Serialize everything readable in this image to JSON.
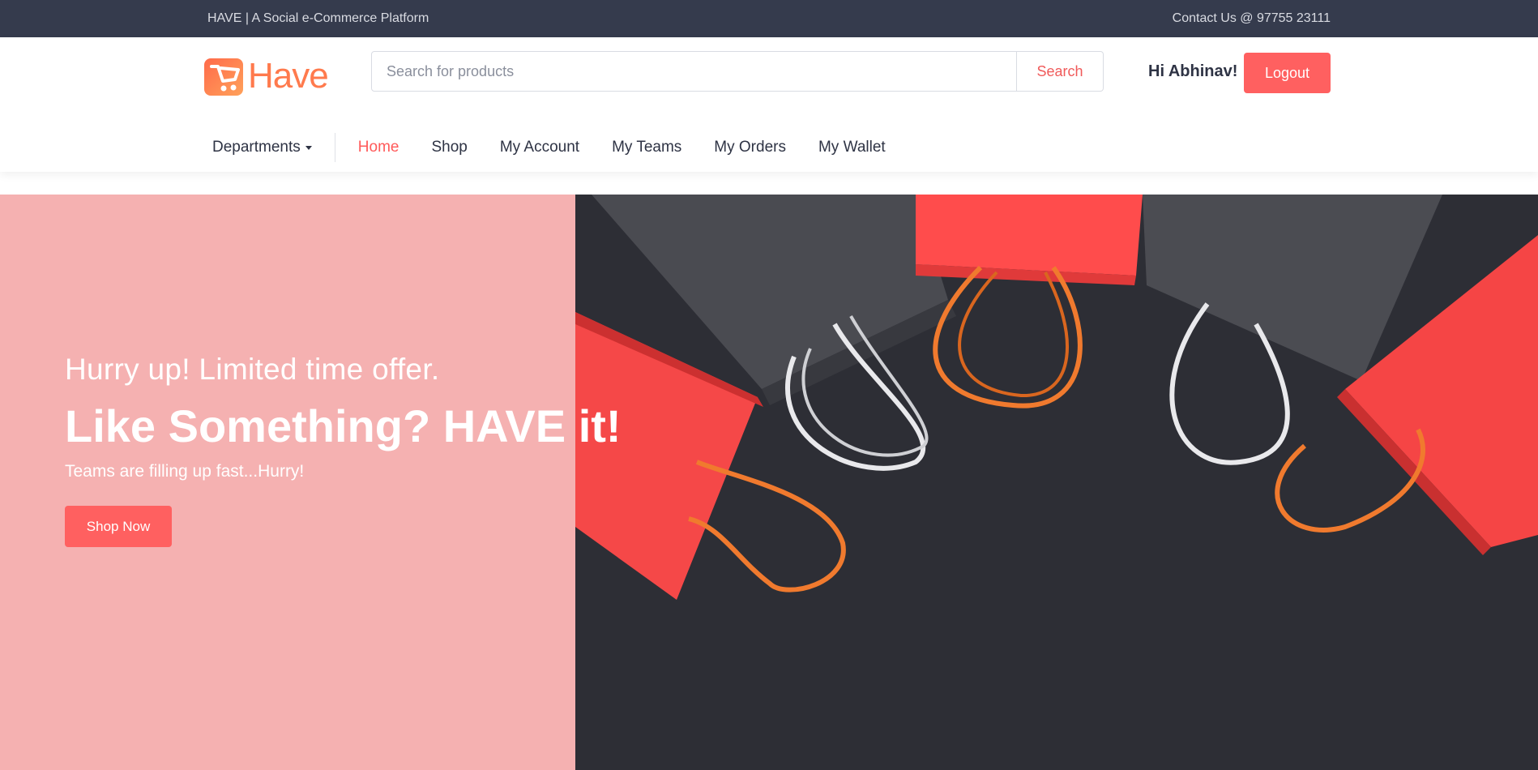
{
  "topbar": {
    "tagline": "HAVE | A Social e-Commerce Platform",
    "contact": "Contact Us @ 97755 23111"
  },
  "header": {
    "logo_text": "Have",
    "search": {
      "placeholder": "Search for products",
      "value": "",
      "button_label": "Search"
    },
    "greeting": "Hi Abhinav!",
    "logout_label": "Logout"
  },
  "nav": {
    "departments_label": "Departments",
    "links": [
      {
        "label": "Home",
        "active": true
      },
      {
        "label": "Shop",
        "active": false
      },
      {
        "label": "My Account",
        "active": false
      },
      {
        "label": "My Teams",
        "active": false
      },
      {
        "label": "My Orders",
        "active": false
      },
      {
        "label": "My Wallet",
        "active": false
      }
    ]
  },
  "hero": {
    "kicker": "Hurry up! Limited time offer.",
    "title": "Like Something? HAVE it!",
    "subtitle": "Teams are filling up fast...Hurry!",
    "cta_label": "Shop Now"
  },
  "colors": {
    "topbar_bg": "#353b4d",
    "accent": "#ff6060",
    "hero_left_bg": "#f5b1b1",
    "logo": "#ff7a4d"
  },
  "icons": {
    "logo": "shopping-cart-icon",
    "departments_caret": "caret-down-icon"
  }
}
